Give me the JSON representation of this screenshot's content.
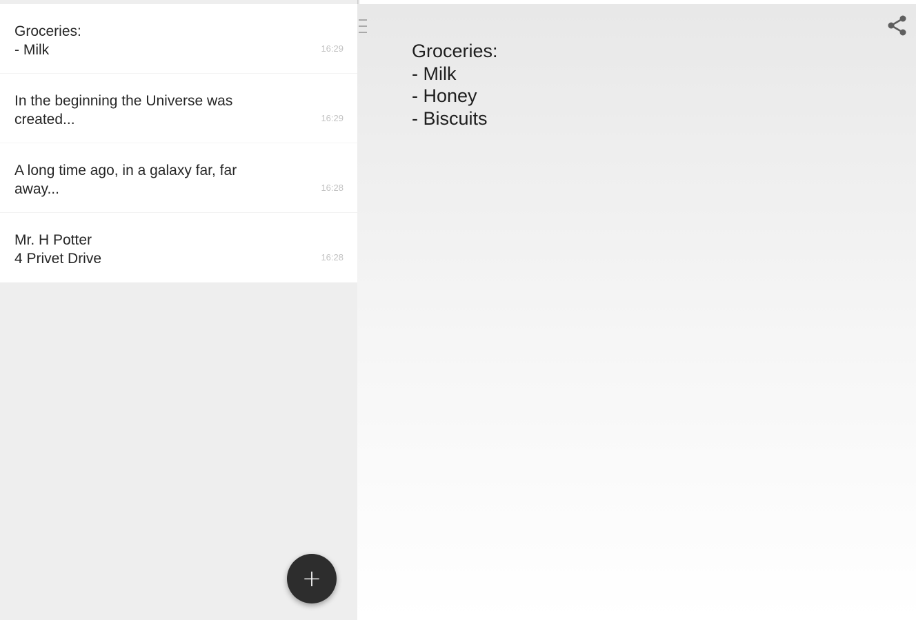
{
  "notes": [
    {
      "text": "Groceries:\n- Milk",
      "time": "16:29"
    },
    {
      "text": "In the beginning the Universe was\ncreated...",
      "time": "16:29"
    },
    {
      "text": "A long time ago, in a galaxy far, far\naway...",
      "time": "16:28"
    },
    {
      "text": "Mr. H Potter\n4 Privet Drive",
      "time": "16:28"
    }
  ],
  "fab": {
    "label": "+",
    "icon": "plus-icon"
  },
  "detail": {
    "body": "Groceries:\n- Milk\n- Honey\n- Biscuits",
    "share_icon": "share-icon",
    "handle_icon": "drag-handle-icon"
  },
  "colors": {
    "fab": "#2d2d2d",
    "list_background": "#eeeeee",
    "text": "#262626",
    "timestamp": "#c2c2c2"
  }
}
